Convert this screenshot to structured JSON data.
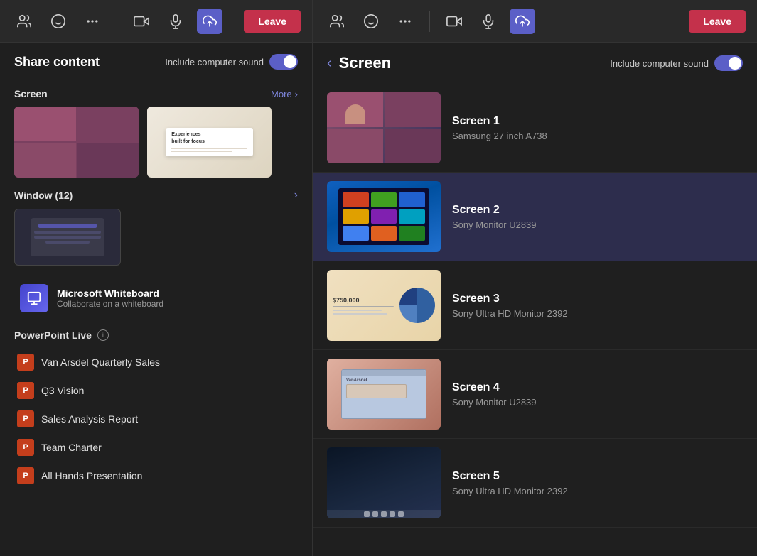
{
  "left": {
    "toolbar": {
      "leave_label": "Leave"
    },
    "share_content_title": "Share content",
    "include_sound_label": "Include computer sound",
    "screen_section": "Screen",
    "more_label": "More",
    "window_section": "Window (12)",
    "whiteboard": {
      "title": "Microsoft Whiteboard",
      "subtitle": "Collaborate on a whiteboard"
    },
    "powerpoint_section": "PowerPoint Live",
    "ppt_files": [
      {
        "name": "Van Arsdel Quarterly Sales"
      },
      {
        "name": "Q3 Vision"
      },
      {
        "name": "Sales Analysis Report"
      },
      {
        "name": "Team Charter"
      },
      {
        "name": "All Hands Presentation"
      }
    ]
  },
  "right": {
    "toolbar": {
      "leave_label": "Leave"
    },
    "back_label": "Screen",
    "include_sound_label": "Include computer sound",
    "screens": [
      {
        "name": "Screen 1",
        "desc": "Samsung 27 inch A738"
      },
      {
        "name": "Screen 2",
        "desc": "Sony Monitor U2839"
      },
      {
        "name": "Screen 3",
        "desc": "Sony Ultra HD Monitor 2392"
      },
      {
        "name": "Screen 4",
        "desc": "Sony Monitor U2839"
      },
      {
        "name": "Screen 5",
        "desc": "Sony Ultra HD Monitor 2392"
      }
    ]
  },
  "icons": {
    "people": "👥",
    "emoji": "😊",
    "more": "•••",
    "video": "📹",
    "mic": "🎤",
    "share": "⬆",
    "back_arrow": "‹",
    "chevron": "›",
    "info": "i"
  }
}
